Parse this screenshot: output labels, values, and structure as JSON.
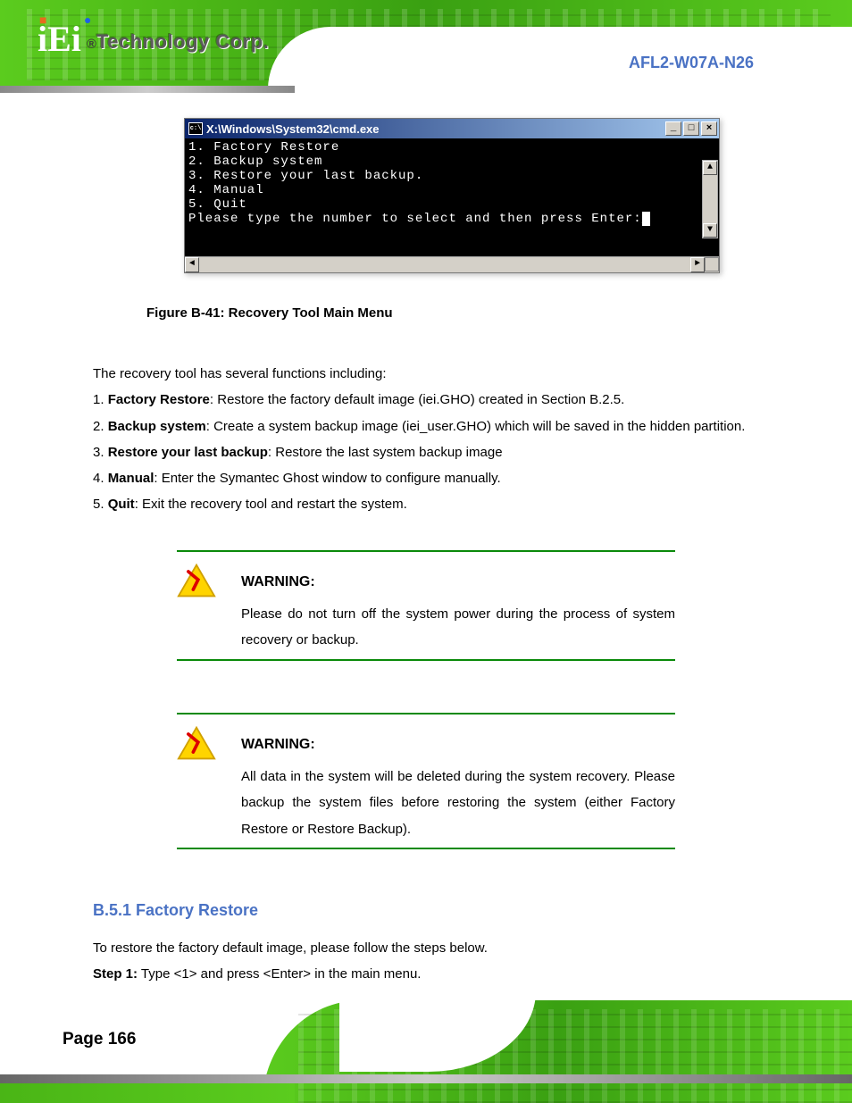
{
  "brand_text": "Technology Corp.",
  "product": "AFL2-W07A-N26",
  "cmd": {
    "title": "X:\\Windows\\System32\\cmd.exe",
    "lines": [
      "1. Factory Restore",
      "2. Backup system",
      "3. Restore your last backup.",
      "4. Manual",
      "5. Quit",
      "Please type the number to select and then press Enter:"
    ]
  },
  "figure_caption": "Figure B-41: Recovery Tool Main Menu",
  "recovery_text_1": "The recovery tool has several functions including:",
  "items": [
    {
      "n": "1.",
      "label": "Factory Restore",
      "desc": ": Restore the factory default image (iei.GHO) created in Section B.2.5."
    },
    {
      "n": "2.",
      "label": "Backup system",
      "desc": ": Create a system backup image (iei_user.GHO) which will be saved in the hidden partition."
    },
    {
      "n": "3.",
      "label": "Restore your last backup",
      "desc": ": Restore the last system backup image"
    },
    {
      "n": "4.",
      "label": "Manual",
      "desc": ": Enter the Symantec Ghost window to configure manually."
    },
    {
      "n": "5.",
      "label": "Quit",
      "desc": ": Exit the recovery tool and restart the system."
    }
  ],
  "warnings": [
    {
      "title": "WARNING:",
      "body": "Please do not turn off the system power during the process of system recovery or backup."
    },
    {
      "title": "WARNING:",
      "body": "All data in the system will be deleted during the system recovery. Please backup the system files before restoring the system (either Factory Restore or Restore Backup)."
    }
  ],
  "recovery_text_2": {
    "step": "Step 1:",
    "body": "Type <1> and press <Enter> in the main menu."
  },
  "restore_heading": "B.5.1 Factory Restore",
  "restore_body": "To restore the factory default image, please follow the steps below.",
  "page_num": "Page 166"
}
